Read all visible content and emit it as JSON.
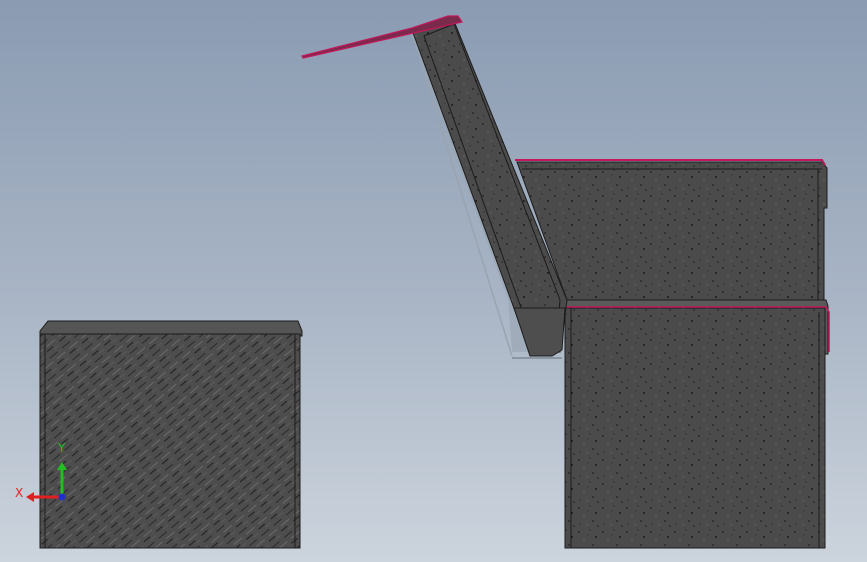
{
  "viewport": {
    "background_top": "#8a9bb2",
    "background_bottom": "#ccd4dd"
  },
  "model": {
    "surface_color": "#4a4a4a",
    "edge_color": "#1c1c1c",
    "highlight_color": "#c2185b",
    "parts": [
      "left-block",
      "seat-base",
      "seat-back-block",
      "backrest-slab"
    ]
  },
  "triad": {
    "x_label": "X",
    "y_label": "Y",
    "x_color": "#e02020",
    "y_color": "#20c020",
    "z_color": "#2030d0"
  }
}
